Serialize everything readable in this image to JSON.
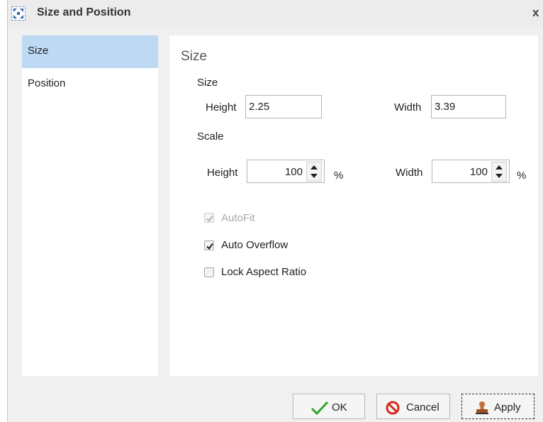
{
  "window": {
    "title": "Size and Position",
    "title_icon": "resize-arrows-icon",
    "close_label": "x"
  },
  "sidebar": {
    "items": [
      {
        "label": "Size",
        "selected": true
      },
      {
        "label": "Position",
        "selected": false
      }
    ]
  },
  "panel": {
    "heading": "Size",
    "size_section": {
      "label": "Size",
      "height_label": "Height",
      "height_value": "2.25",
      "width_label": "Width",
      "width_value": "3.39"
    },
    "scale_section": {
      "label": "Scale",
      "height_label": "Height",
      "height_value": "100",
      "height_unit": "%",
      "width_label": "Width",
      "width_value": "100",
      "width_unit": "%"
    },
    "checkboxes": {
      "autofit": {
        "label": "AutoFit",
        "checked": true,
        "enabled": false
      },
      "auto_overflow": {
        "label": "Auto Overflow",
        "checked": true,
        "enabled": true
      },
      "lock_aspect": {
        "label": "Lock Aspect Ratio",
        "checked": false,
        "enabled": true
      }
    }
  },
  "buttons": {
    "ok": "OK",
    "cancel": "Cancel",
    "apply": "Apply"
  },
  "colors": {
    "selection": "#bed9f4",
    "ok_check": "#2fa62f",
    "cancel_red": "#d42a1f"
  }
}
